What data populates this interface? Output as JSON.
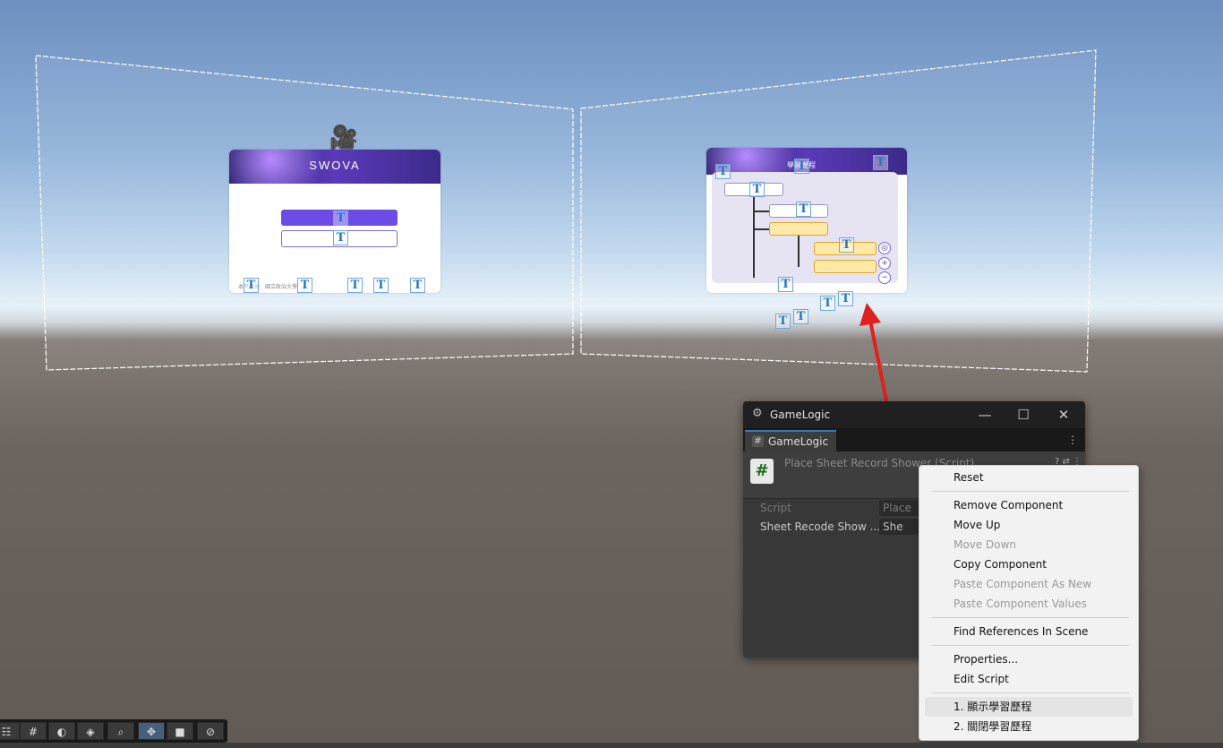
{
  "scene": {
    "left_screen": {
      "logo": "SWOVA",
      "footer_text": "本平台由　國立政治大學"
    },
    "right_screen": {
      "title": "學習歷程"
    }
  },
  "inspector": {
    "window_title": "GameLogic",
    "tab_label": "GameLogic",
    "component_title": "Place Sheet Record Shower (Script)",
    "fields": [
      {
        "label": "Script",
        "value": "Place"
      },
      {
        "label": "Sheet Recode Show ...",
        "value": "She"
      }
    ]
  },
  "context_menu": {
    "items": [
      {
        "label": "Reset",
        "enabled": true
      },
      {
        "label": "Remove Component",
        "enabled": true
      },
      {
        "label": "Move Up",
        "enabled": true
      },
      {
        "label": "Move Down",
        "enabled": false
      },
      {
        "label": "Copy Component",
        "enabled": true
      },
      {
        "label": "Paste Component As New",
        "enabled": false
      },
      {
        "label": "Paste Component Values",
        "enabled": false
      },
      {
        "label": "Find References In Scene",
        "enabled": true
      },
      {
        "label": "Properties...",
        "enabled": true
      },
      {
        "label": "Edit Script",
        "enabled": true
      },
      {
        "label": "1. 顯示學習歷程",
        "enabled": true,
        "highlighted": true
      },
      {
        "label": "2. 關閉學習歷程",
        "enabled": true
      }
    ]
  },
  "toolbar": {
    "tools": [
      "view-tool-icon",
      "grid-icon",
      "lighting-icon",
      "layers-icon",
      "search-icon",
      "move-tool-icon",
      "camera-icon",
      "compass-icon"
    ]
  },
  "colors": {
    "accent": "#3a79bb",
    "arrow": "#e02020",
    "screen_purple": "#6c4ce6"
  }
}
